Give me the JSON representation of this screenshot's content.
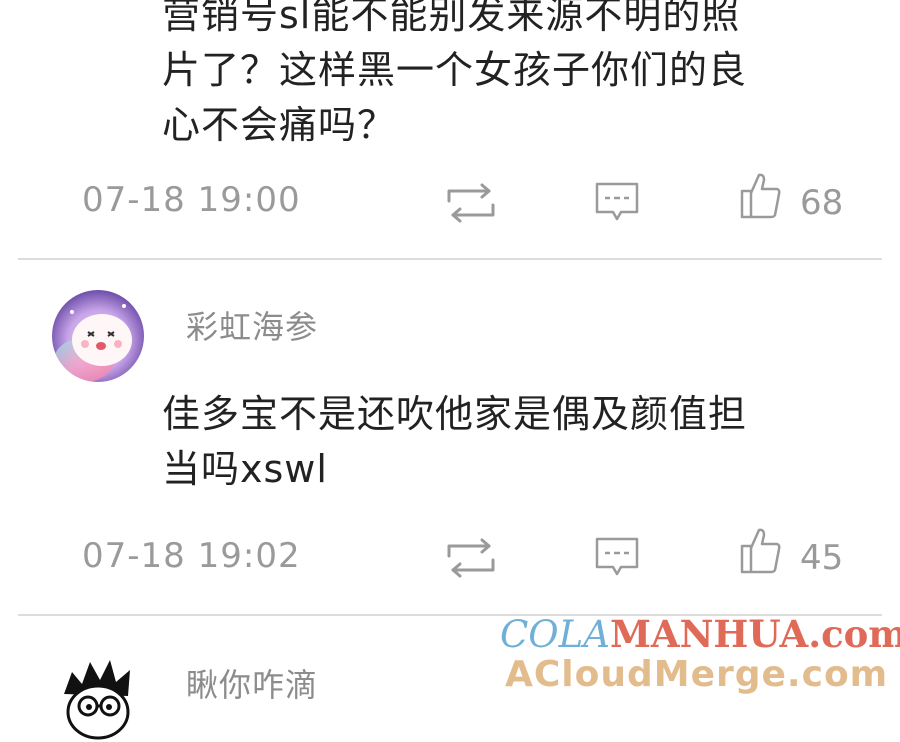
{
  "comments": [
    {
      "text": "营销号sl能不能别发来源不明的照\n片了？这样黑一个女孩子你们的良\n心不会痛吗？",
      "time": "07-18  19:00",
      "likes": "68"
    },
    {
      "username": "彩虹海参",
      "text": "佳多宝不是还吹他家是偶及颜值担\n当吗xswl",
      "time": "07-18  19:02",
      "likes": "45"
    },
    {
      "username": "瞅你咋滴"
    }
  ],
  "watermark": {
    "line1_a": "COLA",
    "line1_b": "MANHUA.com",
    "line2": "ACloudMerge.com"
  },
  "colors": {
    "text": "#222222",
    "meta": "#9a9a9a",
    "divider": "#dcdcdc",
    "watermark_blue": "#6fb0d8",
    "watermark_red": "#e06a58",
    "watermark_tan": "#e3bc8e"
  },
  "icons": [
    "repost-icon",
    "comment-icon",
    "thumbs-up-icon"
  ]
}
